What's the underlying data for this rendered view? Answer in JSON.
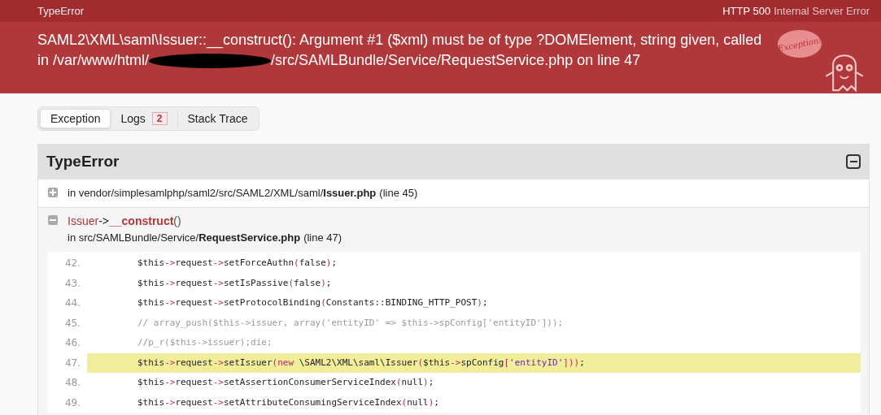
{
  "top_bar": {
    "error_class": "TypeError",
    "status_code": "HTTP 500",
    "status_text": "Internal Server Error"
  },
  "header": {
    "message_line_1": "SAML2\\XML\\saml\\Issuer::__construct(): Argument #1 ($xml) must be of type ?DOMElement, string given, called",
    "message_before_redaction": "in /var/www/html/",
    "redacted": true,
    "message_after_redaction": "/src/SAMLBundle/Service/RequestService.php on line 47",
    "badge_text": "Exception!"
  },
  "tabs": [
    {
      "label": "Exception",
      "selected": true
    },
    {
      "label": "Logs",
      "selected": false,
      "count": "2"
    },
    {
      "label": "Stack Trace",
      "selected": false
    }
  ],
  "exception": {
    "title": "TypeError",
    "expanded": true,
    "frames": [
      {
        "expanded": false,
        "path": "in vendor/simplesamlphp/saml2/src/SAML2/XML/saml/",
        "file": "Issuer.php",
        "line": "(line 45)"
      },
      {
        "expanded": true,
        "class": "Issuer",
        "arrow": "->",
        "function": "__construct",
        "parens": "()",
        "path": "in src/SAMLBundle/Service/",
        "file": "RequestService.php",
        "line": "(line 47)",
        "code": [
          {
            "number": "42.",
            "selected": false,
            "tokens": [
              {
                "kind": "plain",
                "text": "$this"
              },
              {
                "kind": "punct",
                "text": "->"
              },
              {
                "kind": "plain",
                "text": "request"
              },
              {
                "kind": "punct",
                "text": "->"
              },
              {
                "kind": "plain",
                "text": "setForceAuthn"
              },
              {
                "kind": "punct",
                "text": "("
              },
              {
                "kind": "plain",
                "text": "false"
              },
              {
                "kind": "punct",
                "text": ")"
              },
              {
                "kind": "plain",
                "text": ";"
              }
            ]
          },
          {
            "number": "43.",
            "selected": false,
            "tokens": [
              {
                "kind": "plain",
                "text": "$this"
              },
              {
                "kind": "punct",
                "text": "->"
              },
              {
                "kind": "plain",
                "text": "request"
              },
              {
                "kind": "punct",
                "text": "->"
              },
              {
                "kind": "plain",
                "text": "setIsPassive"
              },
              {
                "kind": "punct",
                "text": "("
              },
              {
                "kind": "plain",
                "text": "false"
              },
              {
                "kind": "punct",
                "text": ")"
              },
              {
                "kind": "plain",
                "text": ";"
              }
            ]
          },
          {
            "number": "44.",
            "selected": false,
            "tokens": [
              {
                "kind": "plain",
                "text": "$this"
              },
              {
                "kind": "punct",
                "text": "->"
              },
              {
                "kind": "plain",
                "text": "request"
              },
              {
                "kind": "punct",
                "text": "->"
              },
              {
                "kind": "plain",
                "text": "setProtocolBinding"
              },
              {
                "kind": "punct",
                "text": "("
              },
              {
                "kind": "plain",
                "text": "Constants::BINDING_HTTP_POST"
              },
              {
                "kind": "punct",
                "text": ")"
              },
              {
                "kind": "plain",
                "text": ";"
              }
            ]
          },
          {
            "number": "45.",
            "selected": false,
            "tokens": [
              {
                "kind": "comment",
                "text": "// array_push($this->issuer, array('entityID' => $this->spConfig['entityID']));"
              }
            ]
          },
          {
            "number": "46.",
            "selected": false,
            "tokens": [
              {
                "kind": "comment",
                "text": "//p_r($this->issuer);die;"
              }
            ]
          },
          {
            "number": "47.",
            "selected": true,
            "tokens": [
              {
                "kind": "plain",
                "text": "$this"
              },
              {
                "kind": "punct",
                "text": "->"
              },
              {
                "kind": "plain",
                "text": "request"
              },
              {
                "kind": "punct",
                "text": "->"
              },
              {
                "kind": "plain",
                "text": "setIssuer"
              },
              {
                "kind": "punct",
                "text": "("
              },
              {
                "kind": "keyword",
                "text": "new"
              },
              {
                "kind": "plain",
                "text": " \\SAML2\\XML\\saml\\Issuer"
              },
              {
                "kind": "punct",
                "text": "("
              },
              {
                "kind": "plain",
                "text": "$this"
              },
              {
                "kind": "punct",
                "text": "->"
              },
              {
                "kind": "plain",
                "text": "spConfig"
              },
              {
                "kind": "punct",
                "text": "["
              },
              {
                "kind": "string",
                "text": "'entityID'"
              },
              {
                "kind": "punct",
                "text": "]))"
              },
              {
                "kind": "plain",
                "text": ";"
              }
            ]
          },
          {
            "number": "48.",
            "selected": false,
            "tokens": [
              {
                "kind": "plain",
                "text": "$this"
              },
              {
                "kind": "punct",
                "text": "->"
              },
              {
                "kind": "plain",
                "text": "request"
              },
              {
                "kind": "punct",
                "text": "->"
              },
              {
                "kind": "plain",
                "text": "setAssertionConsumerServiceIndex"
              },
              {
                "kind": "punct",
                "text": "("
              },
              {
                "kind": "plain",
                "text": "null"
              },
              {
                "kind": "punct",
                "text": ")"
              },
              {
                "kind": "plain",
                "text": ";"
              }
            ]
          },
          {
            "number": "49.",
            "selected": false,
            "tokens": [
              {
                "kind": "plain",
                "text": "$this"
              },
              {
                "kind": "punct",
                "text": "->"
              },
              {
                "kind": "plain",
                "text": "request"
              },
              {
                "kind": "punct",
                "text": "->"
              },
              {
                "kind": "plain",
                "text": "setAttributeConsumingServiceIndex"
              },
              {
                "kind": "punct",
                "text": "("
              },
              {
                "kind": "plain",
                "text": "null"
              },
              {
                "kind": "punct",
                "text": ")"
              },
              {
                "kind": "plain",
                "text": ";"
              }
            ]
          }
        ]
      }
    ]
  }
}
